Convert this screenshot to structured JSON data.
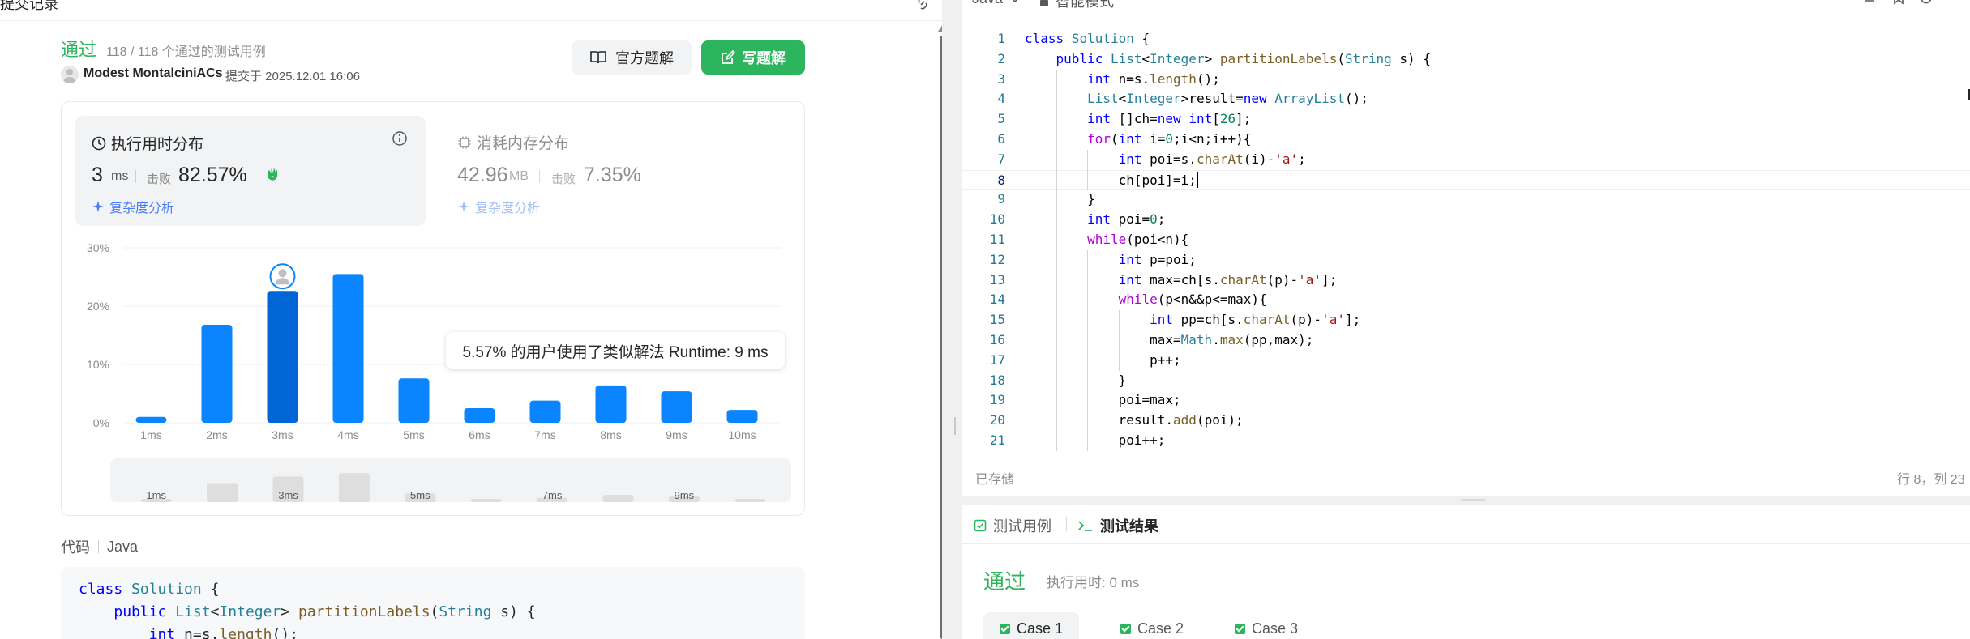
{
  "left_header": {
    "title": "提交记录"
  },
  "submission": {
    "status": "通过",
    "count": "118 / 118 个通过的测试用例",
    "user": "Modest MontalciniACs",
    "submitted_at": "提交于 2025.12.01 16:06",
    "btn_official": "官方题解",
    "btn_write": "写题解"
  },
  "runtime": {
    "title": "执行用时分布",
    "value": "3",
    "unit": "ms",
    "beat_label": "击败",
    "beat_pct": "82.57%",
    "analysis": "复杂度分析"
  },
  "memory": {
    "title": "消耗内存分布",
    "value": "42.96",
    "unit": "MB",
    "beat_label": "击败",
    "beat_pct": "7.35%",
    "analysis": "复杂度分析"
  },
  "tooltip": "5.57% 的用户使用了类似解法 Runtime: 9 ms",
  "chart_data": {
    "type": "bar",
    "categories": [
      "1ms",
      "2ms",
      "3ms",
      "4ms",
      "5ms",
      "6ms",
      "7ms",
      "8ms",
      "9ms",
      "10ms"
    ],
    "values": [
      1.0,
      16.8,
      22.6,
      25.5,
      7.6,
      2.5,
      3.8,
      6.4,
      5.4,
      2.2
    ],
    "highlight_category": "3ms",
    "y_ticks": [
      "0%",
      "10%",
      "20%",
      "30%"
    ],
    "ylim": [
      0,
      30
    ],
    "grid": true,
    "minimap_labels": [
      "1ms",
      "3ms",
      "5ms",
      "7ms",
      "9ms"
    ],
    "colors": {
      "bar": "#0a84ff",
      "highlight": "#0066d6"
    }
  },
  "code_panel": {
    "label": "代码",
    "lang": "Java"
  },
  "code_preview": [
    "class Solution {",
    "    public List<Integer> partitionLabels(String s) {",
    "        int n=s.length();"
  ],
  "editor": {
    "lang": "Java",
    "mode": "智能模式",
    "saved": "已存储",
    "position": "行 8，列 23",
    "lines": [
      "class Solution {",
      "    public List<Integer> partitionLabels(String s) {",
      "        int n=s.length();",
      "        List<Integer>result=new ArrayList();",
      "        int []ch=new int[26];",
      "        for(int i=0;i<n;i++){",
      "            int poi=s.charAt(i)-'a';",
      "            ch[poi]=i;",
      "        }",
      "        int poi=0;",
      "        while(poi<n){",
      "            int p=poi;",
      "            int max=ch[s.charAt(p)-'a'];",
      "            while(p<n&&p<=max){",
      "                int pp=ch[s.charAt(p)-'a'];",
      "                max=Math.max(pp,max);",
      "                p++;",
      "            }",
      "            poi=max;",
      "            result.add(poi);",
      "            poi++;"
    ],
    "line_numbers": [
      "1",
      "2",
      "3",
      "4",
      "5",
      "6",
      "7",
      "8",
      "9",
      "10",
      "11",
      "12",
      "13",
      "14",
      "15",
      "16",
      "17",
      "18",
      "19",
      "20",
      "21"
    ]
  },
  "results": {
    "tab_cases": "测试用例",
    "tab_result": "测试结果",
    "status": "通过",
    "time": "执行用时: 0 ms",
    "cases": [
      "Case 1",
      "Case 2",
      "Case 3"
    ]
  }
}
